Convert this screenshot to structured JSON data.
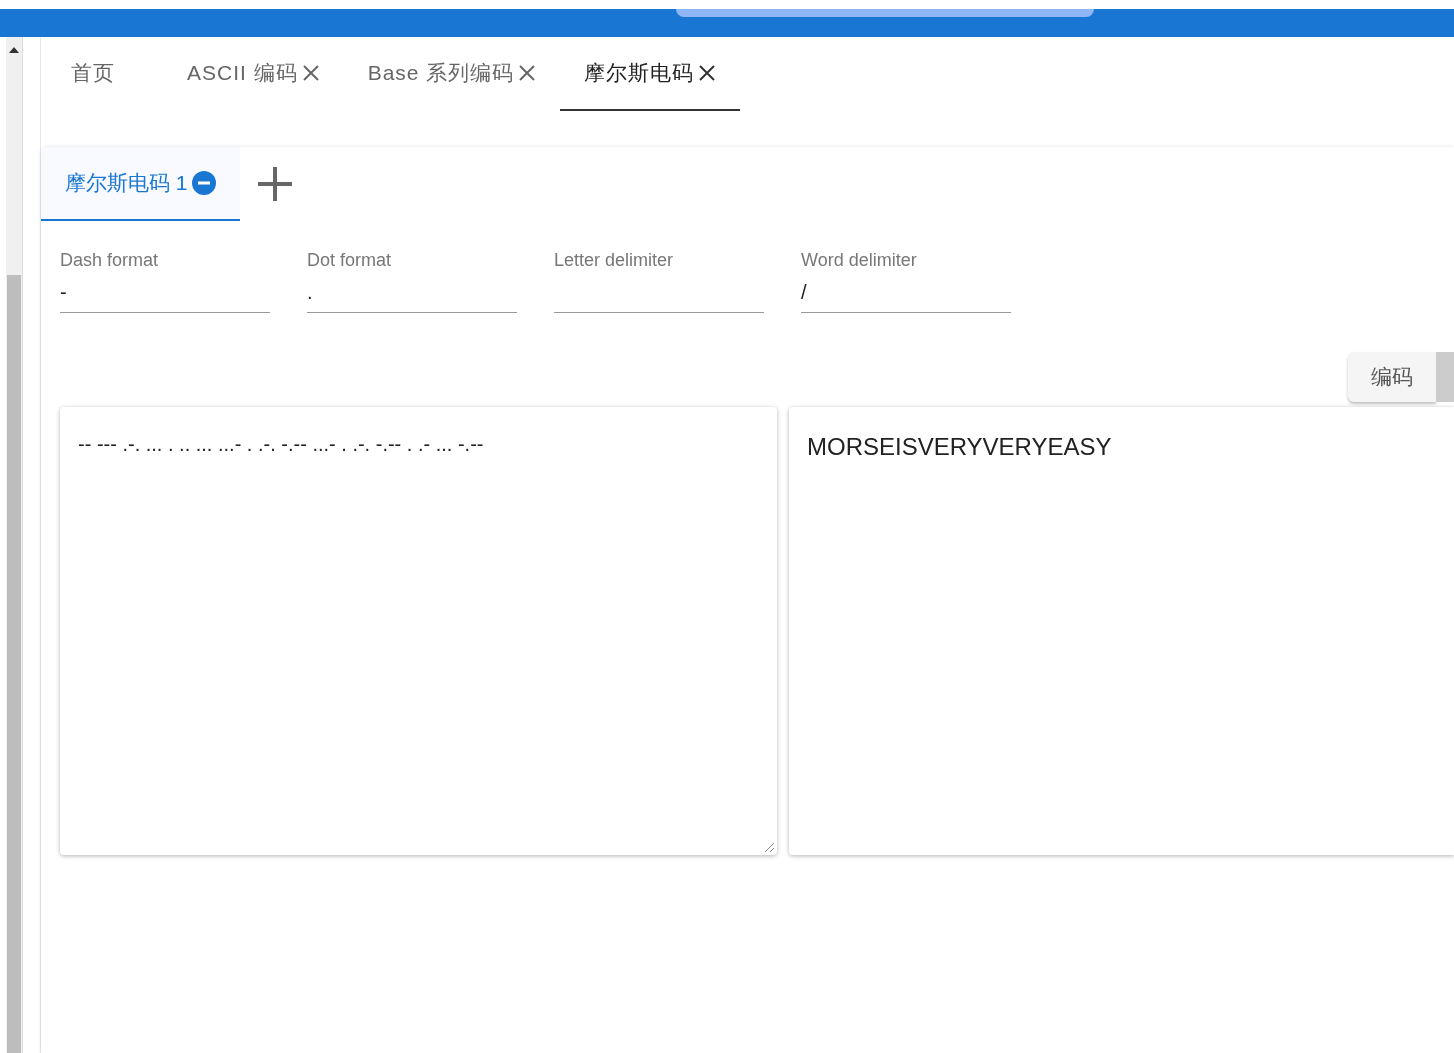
{
  "page_tabs": [
    {
      "label": "首页",
      "closable": false,
      "selected": false
    },
    {
      "label": "ASCII 编码",
      "closable": true,
      "selected": false
    },
    {
      "label": "Base 系列编码",
      "closable": true,
      "selected": false
    },
    {
      "label": "摩尔斯电码",
      "closable": true,
      "selected": true
    }
  ],
  "sub_tabs": [
    {
      "label": "摩尔斯电码 1",
      "selected": true
    }
  ],
  "fields": [
    {
      "label": "Dash format",
      "value": "-"
    },
    {
      "label": "Dot format",
      "value": "."
    },
    {
      "label": "Letter delimiter"
    },
    {
      "label": "Word delimiter",
      "value": "/"
    }
  ],
  "encode_button": "编码",
  "input_text": "-- --- .-. ... . .. ... ...- . .-. -.-- ...- . .-. -.-- . .- ... -.--",
  "output_text": "MORSEISVERYVERYEASY"
}
